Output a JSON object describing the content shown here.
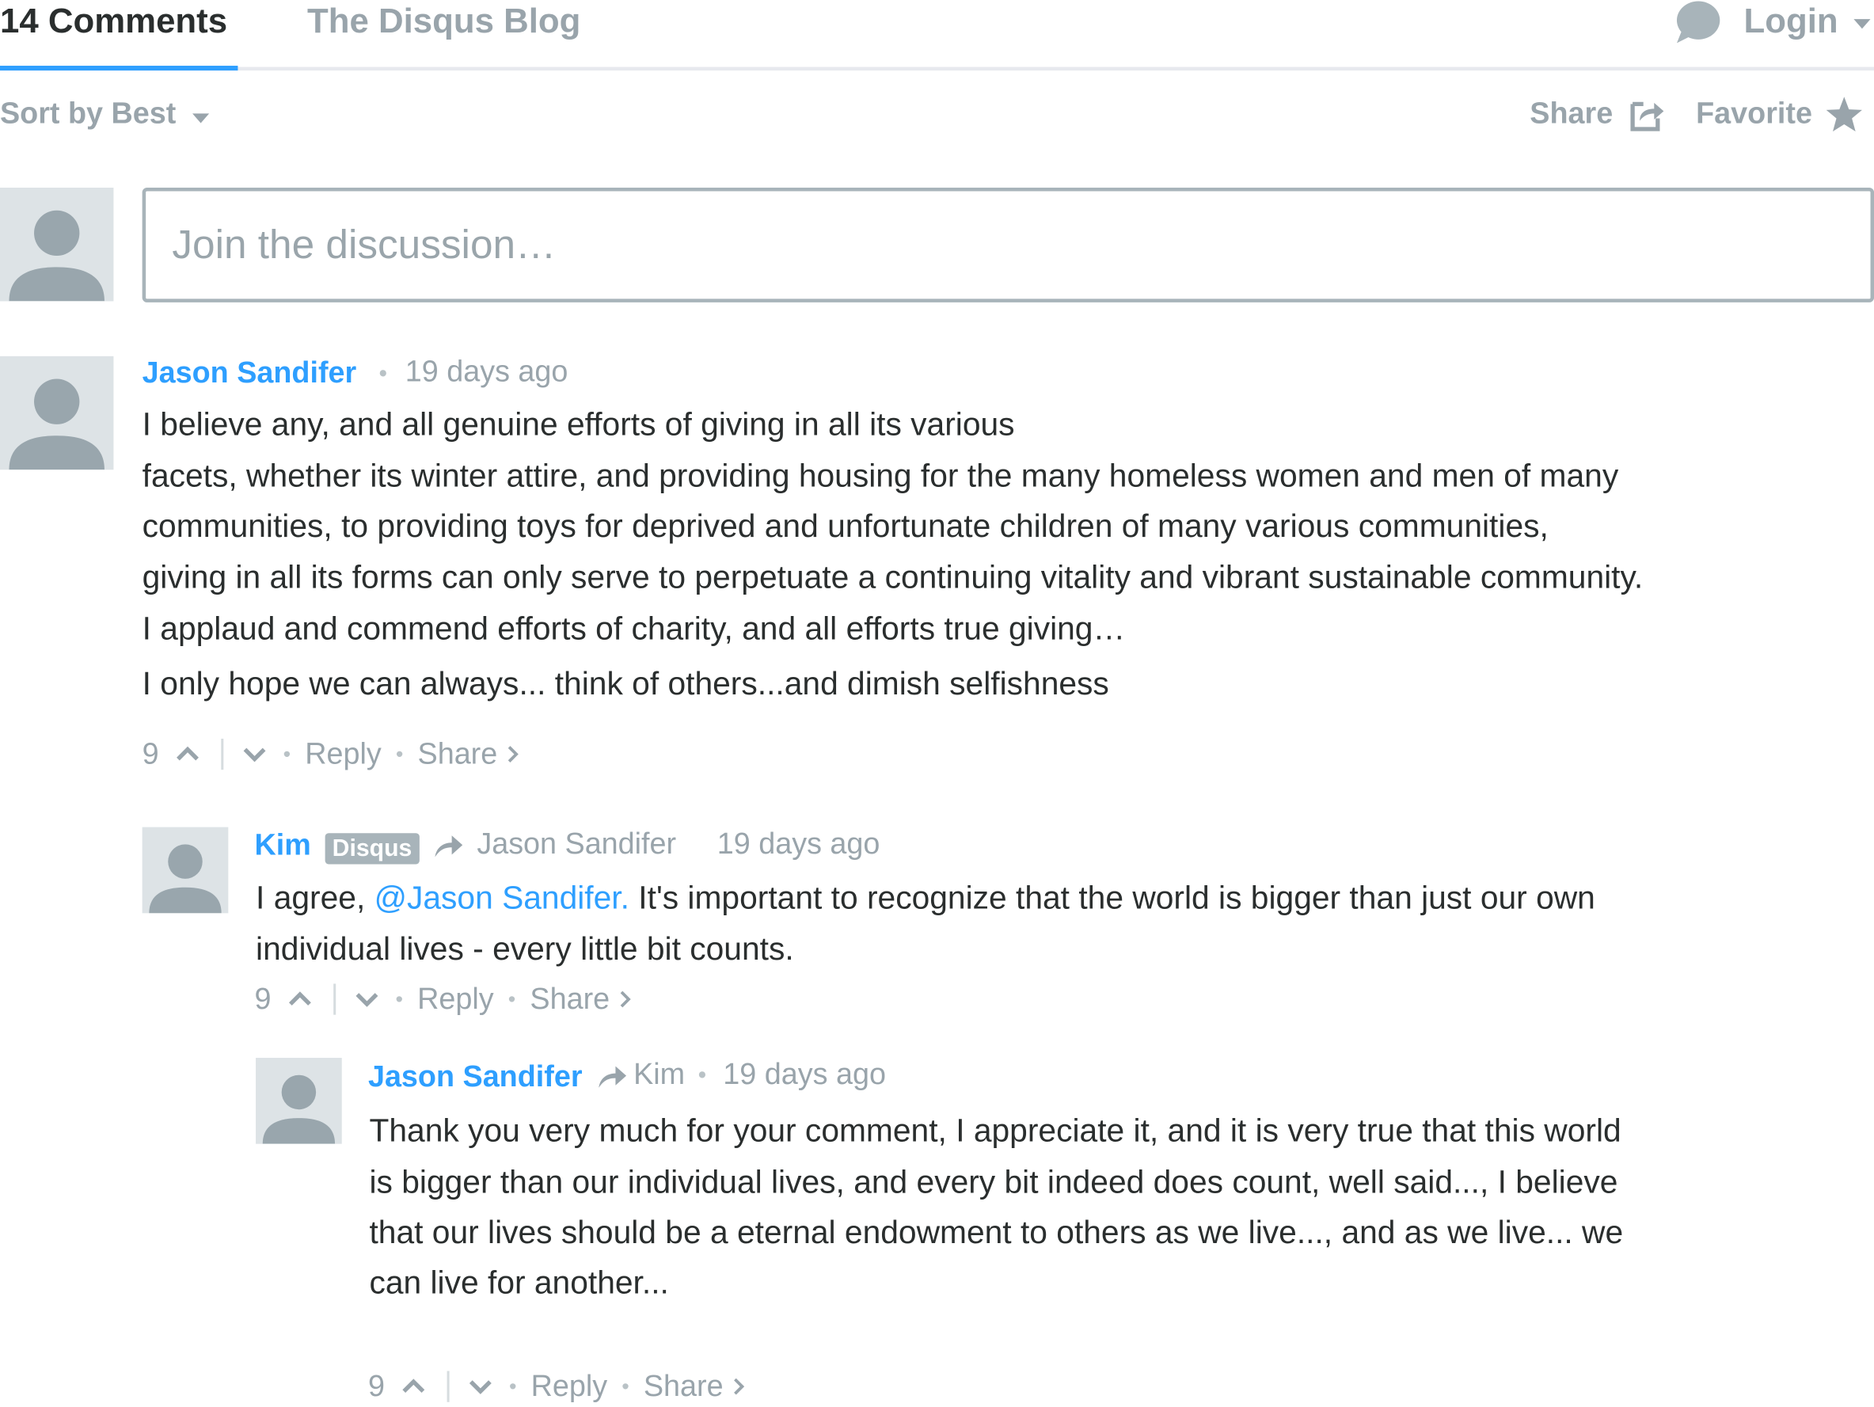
{
  "nav": {
    "comments_tab": "14 Comments",
    "blog_tab": "The Disqus Blog",
    "login": "Login"
  },
  "toolbar": {
    "sort": "Sort by Best",
    "share": "Share",
    "favorite": "Favorite"
  },
  "composer": {
    "placeholder": "Join the discussion…"
  },
  "comments": [
    {
      "author": "Jason Sandifer",
      "time": "19 days ago",
      "lines": [
        "I believe any, and all genuine efforts of giving in all its various",
        "facets, whether its winter attire, and providing housing for the many homeless women and men of many",
        "communities, to providing toys for deprived and unfortunate children of many various communities,",
        "giving in all its forms can only serve to perpetuate a continuing vitality and vibrant sustainable community.",
        "I applaud and commend efforts of charity, and all efforts true giving…",
        "I only hope we can always... think of others...and dimish selfishness"
      ],
      "votes": "9",
      "reply": "Reply",
      "share": "Share"
    },
    {
      "author": "Kim",
      "badge": "Disqus",
      "reply_to": "Jason Sandifer",
      "time": "19 days ago",
      "line1_prefix": "I agree, ",
      "mention": "@Jason Sandifer.",
      "line1_suffix": " It's important to recognize that the world is bigger than just our own",
      "line2": "individual lives - every little bit counts.",
      "votes": "9",
      "reply": "Reply",
      "share": "Share"
    },
    {
      "author": "Jason Sandifer",
      "reply_to": "Kim",
      "time": "19 days ago",
      "lines": [
        "Thank you very much for your comment, I appreciate it, and it is very true that this world",
        "is bigger than our individual lives, and every bit indeed does count, well said..., I believe",
        "that our lives should be a eternal endowment to others as we live..., and as we live... we",
        "can live for another..."
      ],
      "votes": "9",
      "reply": "Reply",
      "share": "Share"
    }
  ],
  "colors": {
    "accent": "#2e9fff",
    "muted": "#99a4ab",
    "text": "#2a2e2e",
    "avatar_bg": "#dde3e6",
    "avatar_fg": "#99a6ad"
  }
}
